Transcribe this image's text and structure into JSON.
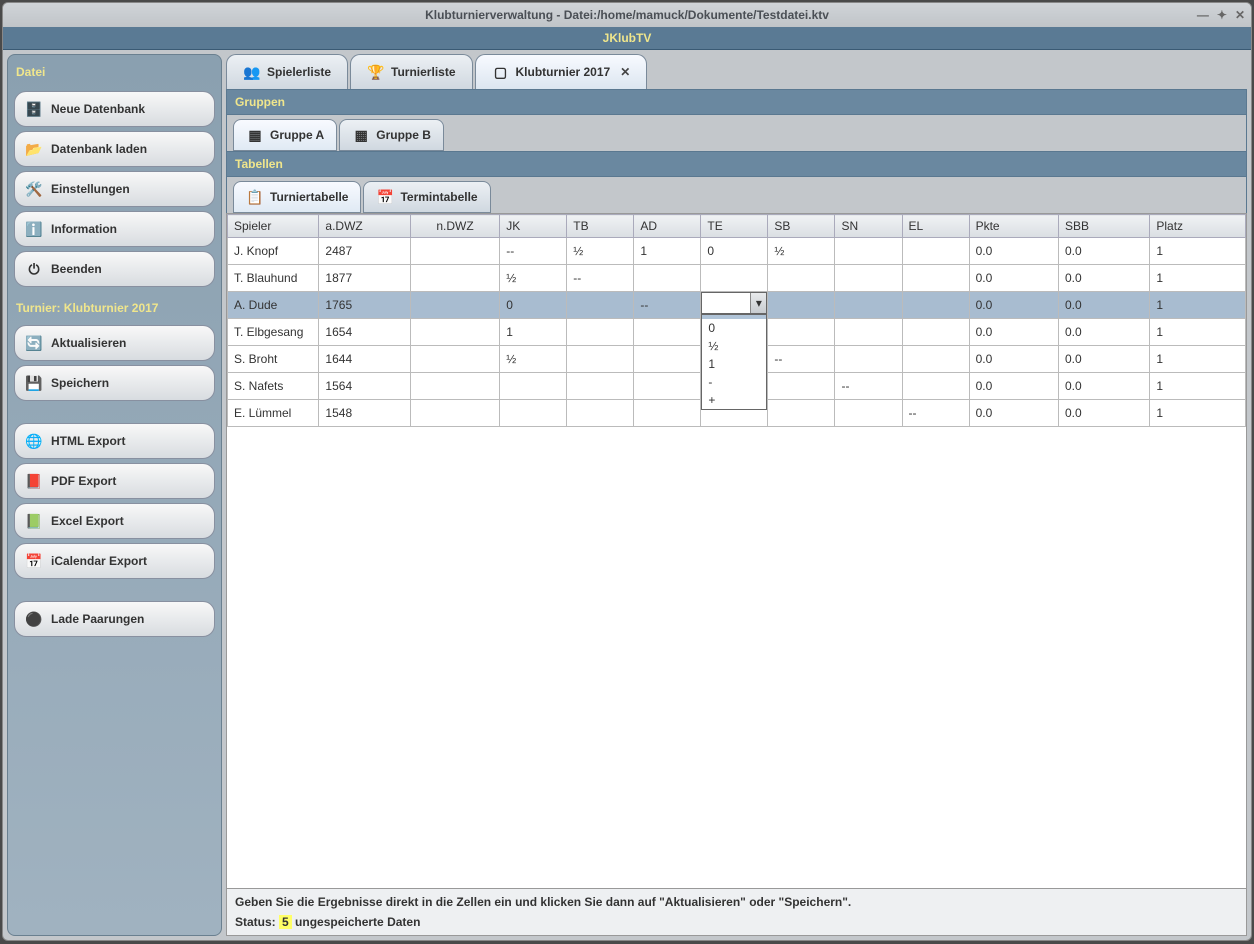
{
  "window": {
    "title": "Klubturnierverwaltung - Datei:/home/mamuck/Dokumente/Testdatei.ktv"
  },
  "app_banner": "JKlubTV",
  "sidebar": {
    "header": "Datei",
    "buttons_file": [
      {
        "icon": "🗄️",
        "label": "Neue Datenbank"
      },
      {
        "icon": "📂",
        "label": "Datenbank laden"
      },
      {
        "icon": "🛠️",
        "label": "Einstellungen"
      },
      {
        "icon": "ℹ️",
        "label": "Information"
      },
      {
        "icon": "⏻",
        "label": "Beenden"
      }
    ],
    "section_tournament": "Turnier: Klubturnier 2017",
    "buttons_tournament": [
      {
        "icon": "🔄",
        "label": "Aktualisieren"
      },
      {
        "icon": "💾",
        "label": "Speichern"
      }
    ],
    "buttons_export": [
      {
        "icon": "🌐",
        "label": "HTML Export"
      },
      {
        "icon": "📕",
        "label": "PDF Export"
      },
      {
        "icon": "📗",
        "label": "Excel Export"
      },
      {
        "icon": "📅",
        "label": "iCalendar Export"
      }
    ],
    "buttons_misc": [
      {
        "icon": "⚫",
        "label": "Lade Paarungen"
      }
    ]
  },
  "tabs": {
    "items": [
      {
        "icon": "👥",
        "label": "Spielerliste",
        "closable": false
      },
      {
        "icon": "🏆",
        "label": "Turnierliste",
        "closable": false
      },
      {
        "icon": "▢",
        "label": "Klubturnier 2017",
        "closable": true
      }
    ]
  },
  "groups": {
    "header": "Gruppen",
    "items": [
      "Gruppe A",
      "Gruppe B"
    ]
  },
  "tables_section": {
    "header": "Tabellen",
    "tabs": [
      "Turniertabelle",
      "Termintabelle"
    ]
  },
  "table": {
    "columns": [
      "Spieler",
      "a.DWZ",
      "n.DWZ",
      "JK",
      "TB",
      "AD",
      "TE",
      "SB",
      "SN",
      "EL",
      "Pkte",
      "SBB",
      "Platz"
    ],
    "rows": [
      {
        "spieler": "J. Knopf",
        "adwz": "2487",
        "ndwz": "",
        "jk": "--",
        "tb": "½",
        "ad": "1",
        "te": "0",
        "sb": "½",
        "sn": "",
        "el": "",
        "pkte": "0.0",
        "sbb": "0.0",
        "platz": "1"
      },
      {
        "spieler": "T. Blauhund",
        "adwz": "1877",
        "ndwz": "",
        "jk": "½",
        "tb": "--",
        "ad": "",
        "te": "",
        "sb": "",
        "sn": "",
        "el": "",
        "pkte": "0.0",
        "sbb": "0.0",
        "platz": "1"
      },
      {
        "spieler": "A. Dude",
        "adwz": "1765",
        "ndwz": "",
        "jk": "0",
        "tb": "",
        "ad": "--",
        "te": "",
        "sb": "",
        "sn": "",
        "el": "",
        "pkte": "0.0",
        "sbb": "0.0",
        "platz": "1",
        "editing": true
      },
      {
        "spieler": "T. Elbgesang",
        "adwz": "1654",
        "ndwz": "",
        "jk": "1",
        "tb": "",
        "ad": "",
        "te": "--",
        "sb": "",
        "sn": "",
        "el": "",
        "pkte": "0.0",
        "sbb": "0.0",
        "platz": "1"
      },
      {
        "spieler": "S. Broht",
        "adwz": "1644",
        "ndwz": "",
        "jk": "½",
        "tb": "",
        "ad": "",
        "te": "",
        "sb": "--",
        "sn": "",
        "el": "",
        "pkte": "0.0",
        "sbb": "0.0",
        "platz": "1"
      },
      {
        "spieler": "S. Nafets",
        "adwz": "1564",
        "ndwz": "",
        "jk": "",
        "tb": "",
        "ad": "",
        "te": "",
        "sb": "",
        "sn": "--",
        "el": "",
        "pkte": "0.0",
        "sbb": "0.0",
        "platz": "1"
      },
      {
        "spieler": "E. Lümmel",
        "adwz": "1548",
        "ndwz": "",
        "jk": "",
        "tb": "",
        "ad": "",
        "te": "",
        "sb": "",
        "sn": "",
        "el": "--",
        "pkte": "0.0",
        "sbb": "0.0",
        "platz": "1"
      }
    ],
    "dropdown_options": [
      "",
      "0",
      "½",
      "1",
      "-",
      "+"
    ]
  },
  "status": {
    "hint": "Geben Sie die Ergebnisse direkt in die Zellen ein und klicken Sie dann auf \"Aktualisieren\" oder \"Speichern\".",
    "label": "Status: ",
    "count": "5",
    "suffix": " ungespeicherte Daten"
  }
}
